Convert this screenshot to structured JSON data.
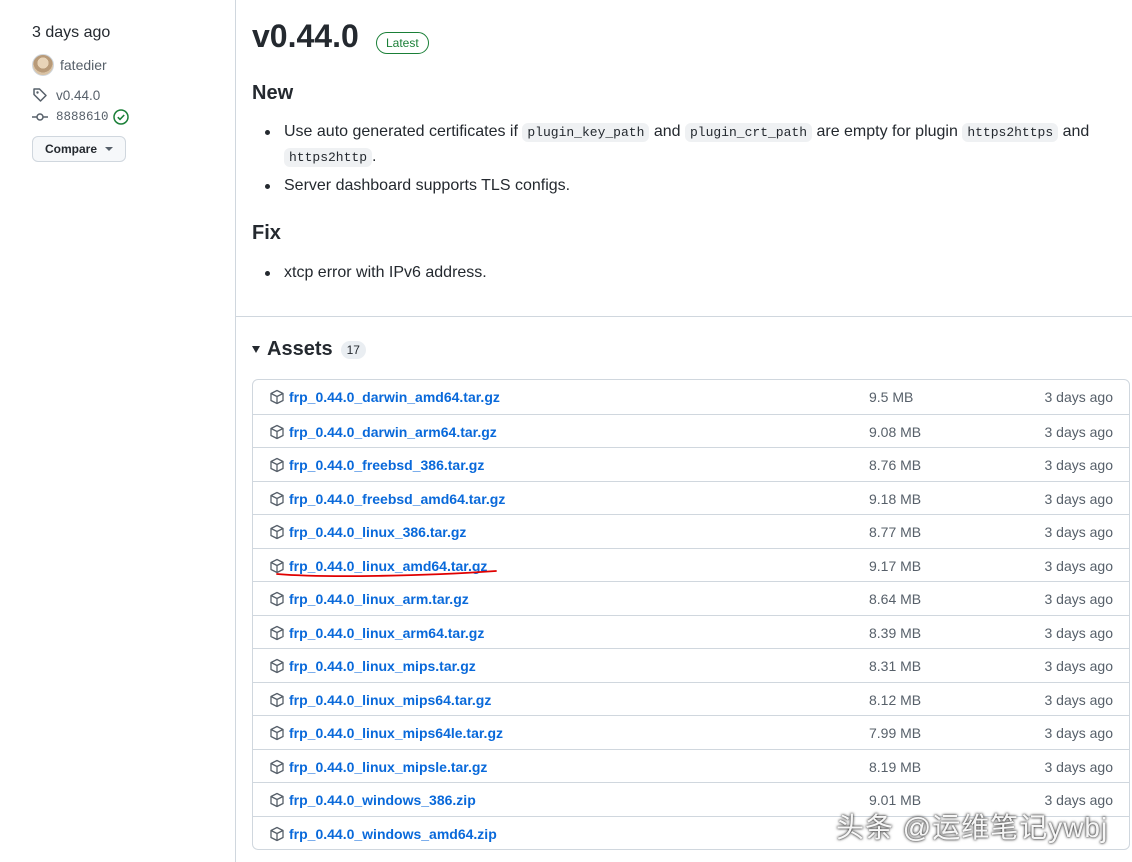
{
  "sidebar": {
    "date": "3 days ago",
    "author": "fatedier",
    "tag": "v0.44.0",
    "commit": "8888610",
    "compare_label": "Compare"
  },
  "release": {
    "title": "v0.44.0",
    "badge": "Latest",
    "new_heading": "New",
    "new_item1": {
      "t1": "Use auto generated certificates if ",
      "c1": "plugin_key_path",
      "t2": " and ",
      "c2": "plugin_crt_path",
      "t3": " are empty for plugin ",
      "c3": "https2https",
      "t4": " and ",
      "c4": "https2http",
      "t5": "."
    },
    "new_item2": "Server dashboard supports TLS configs.",
    "fix_heading": "Fix",
    "fix_item1": "xtcp error with IPv6 address."
  },
  "assets": {
    "heading": "Assets",
    "count": "17",
    "rows": [
      {
        "name": "frp_0.44.0_darwin_amd64.tar.gz",
        "size": "9.5 MB",
        "date": "3 days ago"
      },
      {
        "name": "frp_0.44.0_darwin_arm64.tar.gz",
        "size": "9.08 MB",
        "date": "3 days ago"
      },
      {
        "name": "frp_0.44.0_freebsd_386.tar.gz",
        "size": "8.76 MB",
        "date": "3 days ago"
      },
      {
        "name": "frp_0.44.0_freebsd_amd64.tar.gz",
        "size": "9.18 MB",
        "date": "3 days ago"
      },
      {
        "name": "frp_0.44.0_linux_386.tar.gz",
        "size": "8.77 MB",
        "date": "3 days ago"
      },
      {
        "name": "frp_0.44.0_linux_amd64.tar.gz",
        "size": "9.17 MB",
        "date": "3 days ago"
      },
      {
        "name": "frp_0.44.0_linux_arm.tar.gz",
        "size": "8.64 MB",
        "date": "3 days ago"
      },
      {
        "name": "frp_0.44.0_linux_arm64.tar.gz",
        "size": "8.39 MB",
        "date": "3 days ago"
      },
      {
        "name": "frp_0.44.0_linux_mips.tar.gz",
        "size": "8.31 MB",
        "date": "3 days ago"
      },
      {
        "name": "frp_0.44.0_linux_mips64.tar.gz",
        "size": "8.12 MB",
        "date": "3 days ago"
      },
      {
        "name": "frp_0.44.0_linux_mips64le.tar.gz",
        "size": "7.99 MB",
        "date": "3 days ago"
      },
      {
        "name": "frp_0.44.0_linux_mipsle.tar.gz",
        "size": "8.19 MB",
        "date": "3 days ago"
      },
      {
        "name": "frp_0.44.0_windows_386.zip",
        "size": "9.01 MB",
        "date": "3 days ago"
      },
      {
        "name": "frp_0.44.0_windows_amd64.zip",
        "size": "",
        "date": ""
      }
    ]
  },
  "watermark": "头条 @运维笔记ywbj",
  "colors": {
    "link": "#0969da",
    "badge": "#1a7f37",
    "annotation": "#e00000"
  }
}
